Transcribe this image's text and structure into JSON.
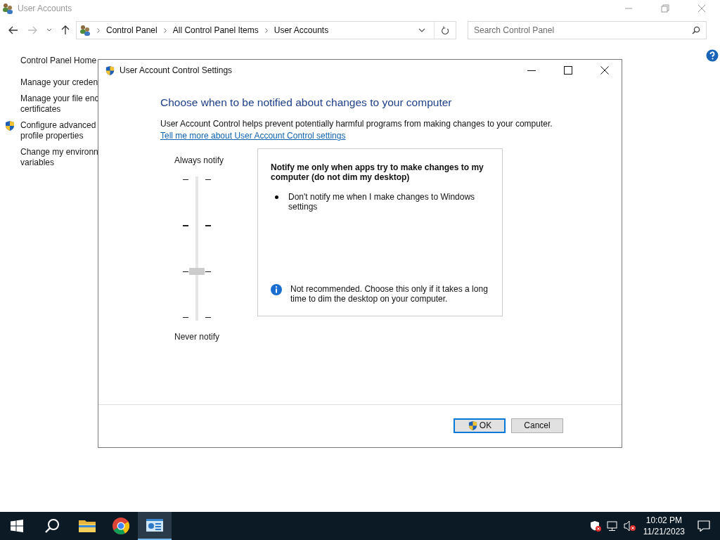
{
  "window": {
    "title": "User Accounts"
  },
  "address_bar": {
    "breadcrumbs": [
      "Control Panel",
      "All Control Panel Items",
      "User Accounts"
    ]
  },
  "search": {
    "placeholder": "Search Control Panel"
  },
  "sidebar": {
    "items": [
      {
        "kind": "plain",
        "lines": [
          "Control Panel Home"
        ]
      },
      {
        "kind": "link",
        "lines": [
          "Manage your creden"
        ]
      },
      {
        "kind": "link",
        "lines": [
          "Manage your file enc",
          "certificates"
        ]
      },
      {
        "kind": "shield",
        "lines": [
          "Configure advanced",
          "profile properties"
        ]
      },
      {
        "kind": "link",
        "lines": [
          "Change my environn",
          "variables"
        ]
      }
    ]
  },
  "dialog": {
    "title": "User Account Control Settings",
    "heading": "Choose when to be notified about changes to your computer",
    "description": "User Account Control helps prevent potentially harmful programs from making changes to your computer.",
    "link": "Tell me more about User Account Control settings",
    "slider": {
      "top_label": "Always notify",
      "bottom_label": "Never notify",
      "level": 0.333
    },
    "panel": {
      "title": "Notify me only when apps try to make changes to my computer (do not dim my desktop)",
      "bullets": [
        "Don't notify me when I make changes to Windows settings"
      ],
      "note": "Not recommended. Choose this only if it takes a long time to dim the desktop on your computer."
    },
    "buttons": [
      {
        "label": "OK",
        "kind": "shield",
        "default": true
      },
      {
        "label": "Cancel",
        "kind": "plain",
        "default": false
      }
    ]
  },
  "taskbar": {
    "apps": [
      {
        "kind": "folder",
        "active": false
      },
      {
        "kind": "browser",
        "active": false
      },
      {
        "kind": "panel",
        "active": true
      }
    ],
    "time": "10:02 PM",
    "date": "11/21/2023"
  }
}
